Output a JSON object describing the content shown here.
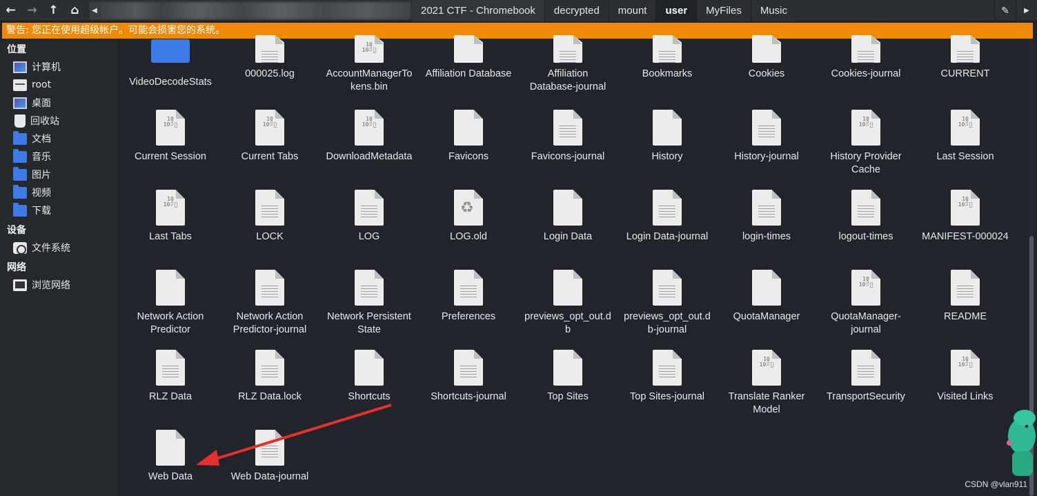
{
  "toolbar": {
    "back_icon": "←",
    "forward_icon": "→",
    "up_icon": "↑",
    "home_icon": "⌂",
    "path_left_icon": "◀",
    "path_right_icon": "▶",
    "edit_icon": "✎",
    "breadcrumbs": [
      "2021 CTF - Chromebook",
      "decrypted",
      "mount",
      "user",
      "MyFiles",
      "Music"
    ],
    "active_crumb": "user"
  },
  "warning": "警告: 您正在使用超级帐户。可能会损害您的系统。",
  "sidebar": {
    "sections": [
      {
        "title": "位置",
        "items": [
          {
            "label": "计算机",
            "icon": "computer-icon"
          },
          {
            "label": "root",
            "icon": "home-folder-icon"
          },
          {
            "label": "桌面",
            "icon": "desktop-icon"
          },
          {
            "label": "回收站",
            "icon": "trash-icon"
          },
          {
            "label": "文档",
            "icon": "folder-icon"
          },
          {
            "label": "音乐",
            "icon": "folder-icon"
          },
          {
            "label": "图片",
            "icon": "folder-icon"
          },
          {
            "label": "视频",
            "icon": "folder-icon"
          },
          {
            "label": "下载",
            "icon": "download-folder-icon"
          }
        ]
      },
      {
        "title": "设备",
        "items": [
          {
            "label": "文件系统",
            "icon": "drive-icon"
          }
        ]
      },
      {
        "title": "网络",
        "items": [
          {
            "label": "浏览网络",
            "icon": "network-icon"
          }
        ]
      }
    ]
  },
  "files": [
    {
      "name": "VideoDecodeStats",
      "kind": "folder"
    },
    {
      "name": "000025.log",
      "kind": "text"
    },
    {
      "name": "AccountManagerTokens.bin",
      "kind": "bin"
    },
    {
      "name": "Affiliation Database",
      "kind": "blank"
    },
    {
      "name": "Affiliation Database-journal",
      "kind": "text"
    },
    {
      "name": "Bookmarks",
      "kind": "text"
    },
    {
      "name": "Cookies",
      "kind": "blank"
    },
    {
      "name": "Cookies-journal",
      "kind": "text"
    },
    {
      "name": "CURRENT",
      "kind": "text"
    },
    {
      "name": "Current Session",
      "kind": "bin"
    },
    {
      "name": "Current Tabs",
      "kind": "bin"
    },
    {
      "name": "DownloadMetadata",
      "kind": "bin"
    },
    {
      "name": "Favicons",
      "kind": "blank"
    },
    {
      "name": "Favicons-journal",
      "kind": "text"
    },
    {
      "name": "History",
      "kind": "blank"
    },
    {
      "name": "History-journal",
      "kind": "text"
    },
    {
      "name": "History Provider Cache",
      "kind": "bin"
    },
    {
      "name": "Last Session",
      "kind": "bin"
    },
    {
      "name": "Last Tabs",
      "kind": "bin"
    },
    {
      "name": "LOCK",
      "kind": "text"
    },
    {
      "name": "LOG",
      "kind": "text"
    },
    {
      "name": "LOG.old",
      "kind": "recycle"
    },
    {
      "name": "Login Data",
      "kind": "blank"
    },
    {
      "name": "Login Data-journal",
      "kind": "text"
    },
    {
      "name": "login-times",
      "kind": "text"
    },
    {
      "name": "logout-times",
      "kind": "text"
    },
    {
      "name": "MANIFEST-000024",
      "kind": "bin"
    },
    {
      "name": "Network Action Predictor",
      "kind": "blank"
    },
    {
      "name": "Network Action Predictor-journal",
      "kind": "text"
    },
    {
      "name": "Network Persistent State",
      "kind": "text"
    },
    {
      "name": "Preferences",
      "kind": "text"
    },
    {
      "name": "previews_opt_out.db",
      "kind": "blank"
    },
    {
      "name": "previews_opt_out.db-journal",
      "kind": "text"
    },
    {
      "name": "QuotaManager",
      "kind": "blank"
    },
    {
      "name": "QuotaManager-journal",
      "kind": "bin"
    },
    {
      "name": "README",
      "kind": "text"
    },
    {
      "name": "RLZ Data",
      "kind": "text"
    },
    {
      "name": "RLZ Data.lock",
      "kind": "text"
    },
    {
      "name": "Shortcuts",
      "kind": "blank"
    },
    {
      "name": "Shortcuts-journal",
      "kind": "text"
    },
    {
      "name": "Top Sites",
      "kind": "blank"
    },
    {
      "name": "Top Sites-journal",
      "kind": "text"
    },
    {
      "name": "Translate Ranker Model",
      "kind": "bin"
    },
    {
      "name": "TransportSecurity",
      "kind": "text"
    },
    {
      "name": "Visited Links",
      "kind": "bin"
    },
    {
      "name": "Web Data",
      "kind": "blank"
    },
    {
      "name": "Web Data-journal",
      "kind": "text"
    }
  ],
  "file_labels": {
    "AccountManagerTokens.bin": "AccountManagerTo\nkens.bin",
    "Affiliation Database-journal": "Affiliation\nDatabase-journal",
    "History Provider Cache": "History Provider\nCache",
    "Network Action Predictor": "Network Action\nPredictor",
    "Network Action Predictor-journal": "Network Action\nPredictor-journal",
    "Network Persistent State": "Network Persistent\nState",
    "previews_opt_out.db": "previews_opt_out.d\nb",
    "previews_opt_out.db-journal": "previews_opt_out.d\nb-journal",
    "QuotaManager-journal": "QuotaManager-\njournal",
    "Translate Ranker Model": "Translate Ranker\nModel"
  },
  "annotation": {
    "arrow_color": "#e8302a",
    "target": "Web Data"
  },
  "watermark": "CSDN @vlan911",
  "colors": {
    "warning_bg": "#f08a06",
    "folder": "#3d7ce8",
    "background": "#21252b"
  }
}
